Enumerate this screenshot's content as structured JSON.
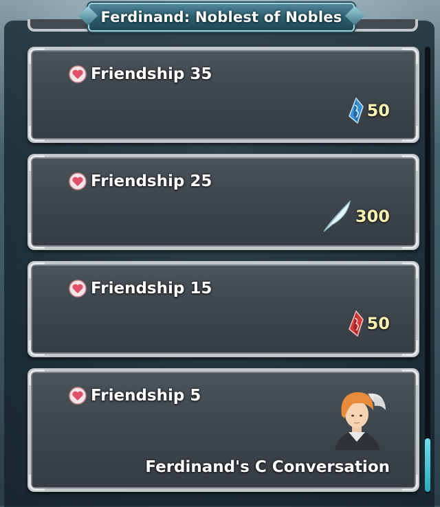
{
  "header": {
    "title": "Ferdinand: Noblest of Nobles"
  },
  "rewards": [
    {
      "friendship_label": "Friendship",
      "level": "35",
      "reward_icon": "blue-crystal-icon",
      "reward_qty": "50"
    },
    {
      "friendship_label": "Friendship",
      "level": "25",
      "reward_icon": "feather-icon",
      "reward_qty": "300"
    },
    {
      "friendship_label": "Friendship",
      "level": "15",
      "reward_icon": "red-crystal-icon",
      "reward_qty": "50"
    },
    {
      "friendship_label": "Friendship",
      "level": "5",
      "reward_icon": "ferdinand-portrait",
      "reward_text": "Ferdinand's C Conversation"
    }
  ],
  "colors": {
    "accent": "#6ee0ef",
    "reward_text": "#f7f0b0",
    "heart": "#e0506a"
  }
}
